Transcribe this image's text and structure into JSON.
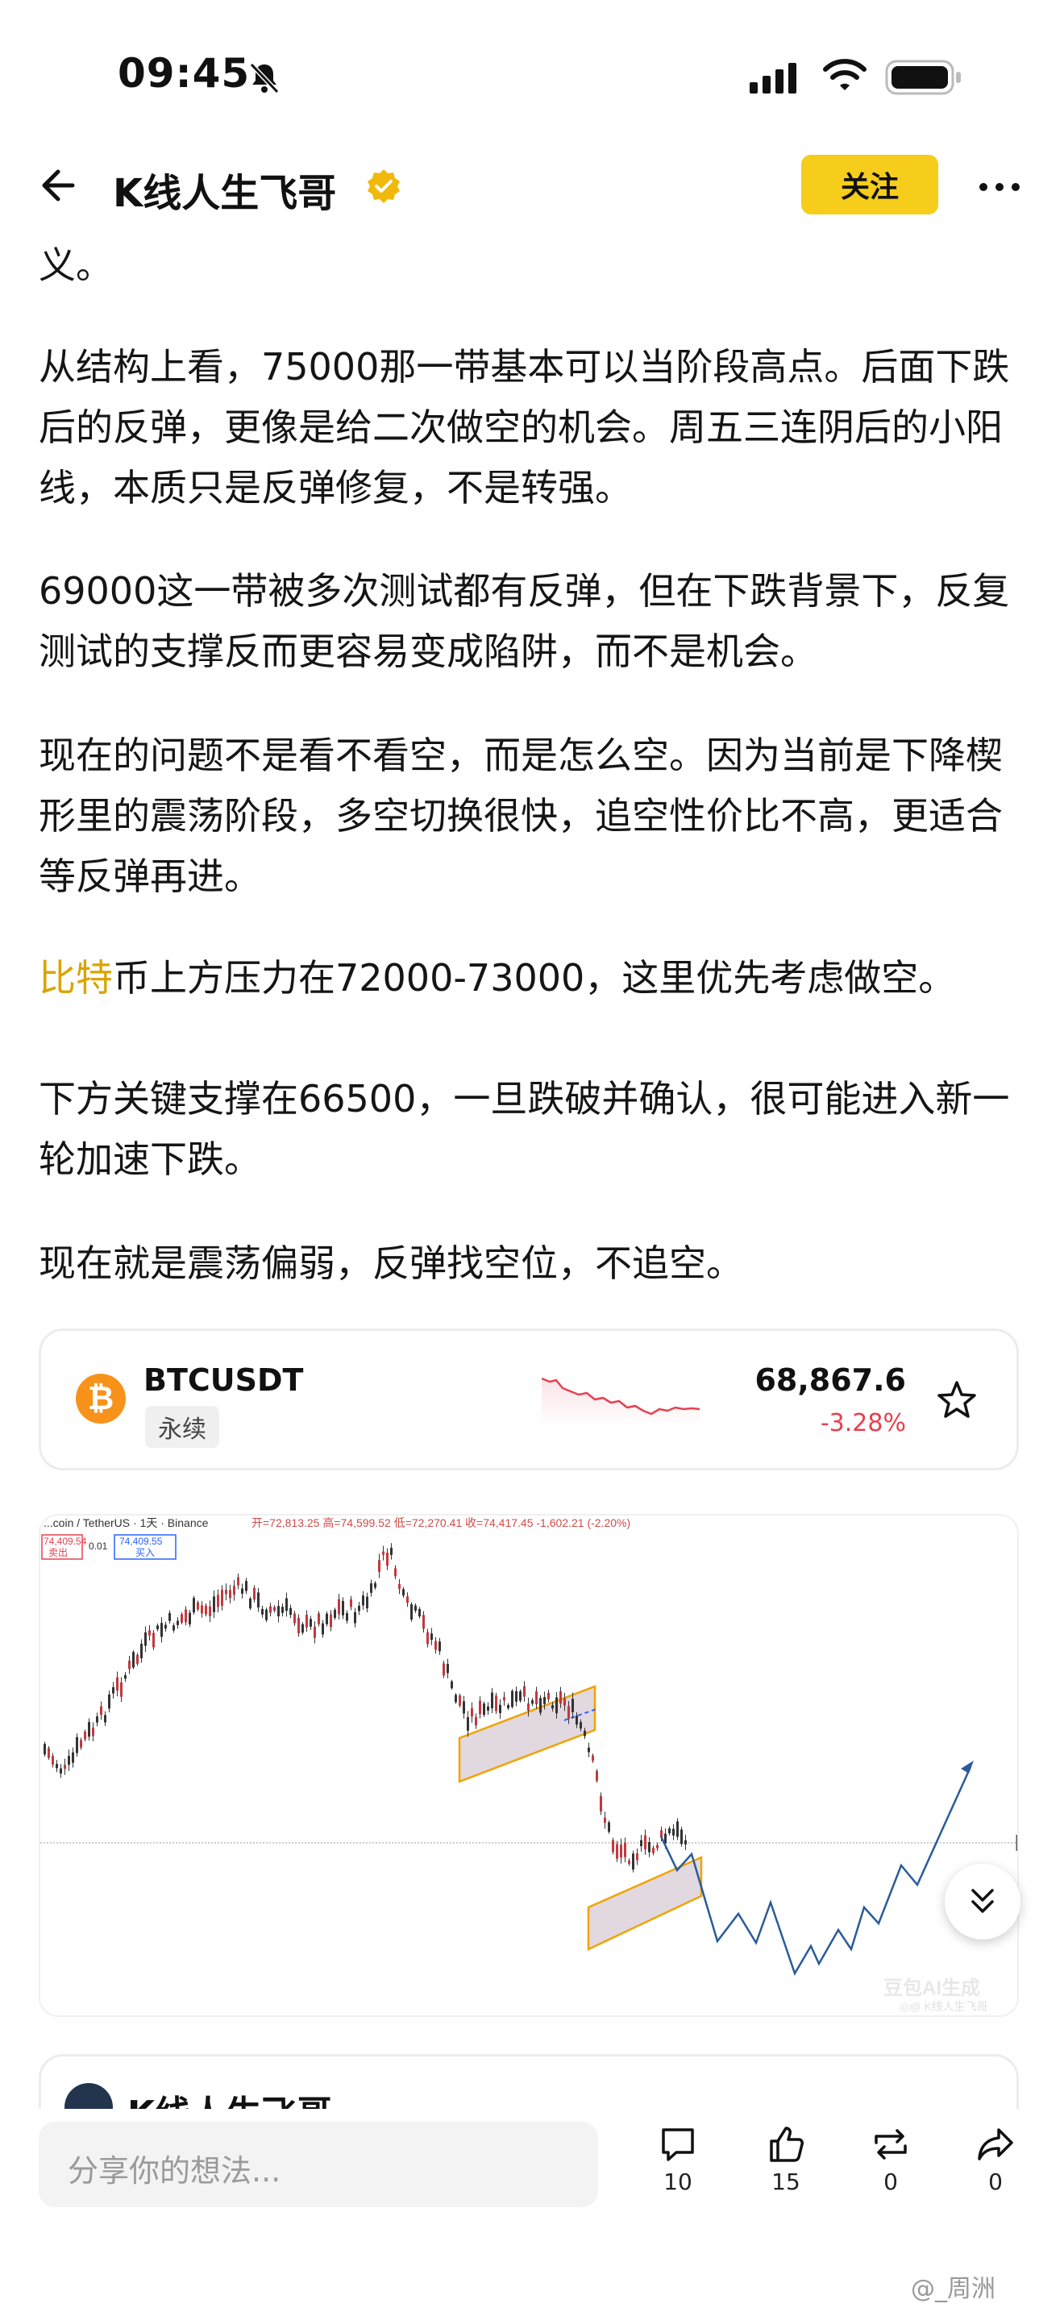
{
  "status_bar": {
    "time": "09:45"
  },
  "header": {
    "title": "K线人生飞哥",
    "follow_label": "关注"
  },
  "article": {
    "p0": "义。",
    "p1": "从结构上看，75000那一带基本可以当阶段高点。后面下跌后的反弹，更像是给二次做空的机会。周五三连阴后的小阳线，本质只是反弹修复，不是转强。",
    "p2": "69000这一带被多次测试都有反弹，但在下跌背景下，反复测试的支撑反而更容易变成陷阱，而不是机会。",
    "p3": "现在的问题不是看不看空，而是怎么空。因为当前是下降楔形里的震荡阶段，多空切换很快，追空性价比不高，更适合等反弹再进。",
    "p4_highlight": "比特",
    "p4_rest": "币上方压力在72000-73000，这里优先考虑做空。",
    "p5": "下方关键支撑在66500，一旦跌破并确认，很可能进入新一轮加速下跌。",
    "p6": "现在就是震荡偏弱，反弹找空位，不追空。"
  },
  "ticker": {
    "symbol": "BTCUSDT",
    "badge": "永续",
    "price": "68,867.6",
    "change": "-3.28%",
    "change_color": "#e5414f",
    "icon": "bitcoin-icon"
  },
  "chart_image": {
    "header_text": "...coin / TetherUS · 1天 · Binance",
    "ohlc_text": "开=72,813.25 高=74,599.52 低=72,270.41 收=74,417.45 -1,602.21 (-2.20%)",
    "sell_price": "74,409.54",
    "sell_label": "卖出",
    "spread": "0.01",
    "buy_price": "74,409.55",
    "buy_label": "买入",
    "watermark": "豆包AI生成",
    "watermark_sub": "◎@ K线人生飞哥"
  },
  "next_card": {
    "name": "K线人生飞哥"
  },
  "bottom_bar": {
    "comment_placeholder": "分享你的想法...",
    "comments": "10",
    "likes": "15",
    "reposts": "0",
    "shares": "0"
  },
  "watermark": "@_周洲",
  "colors": {
    "accent": "#f5cd1a",
    "highlight": "#d9a400",
    "down": "#e5414f"
  }
}
